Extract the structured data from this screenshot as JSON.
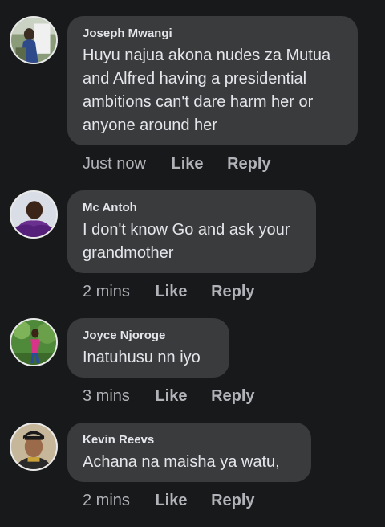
{
  "comments": [
    {
      "author": "Joseph Mwangi",
      "text": "Huyu najua akona nudes za Mutua and Alfred having a presidential ambitions can't dare harm her or anyone around her",
      "time": "Just now",
      "like": "Like",
      "reply": "Reply"
    },
    {
      "author": "Mc Antoh",
      "text": "I don't know Go and ask your grandmother",
      "time": "2 mins",
      "like": "Like",
      "reply": "Reply"
    },
    {
      "author": "Joyce Njoroge",
      "text": "Inatuhusu nn iyo",
      "time": "3 mins",
      "like": "Like",
      "reply": "Reply"
    },
    {
      "author": "Kevin Reevs",
      "text": "Achana na maisha ya watu,",
      "time": "2 mins",
      "like": "Like",
      "reply": "Reply"
    }
  ],
  "colors": {
    "background": "#18191a",
    "bubble": "#3a3b3c",
    "text": "#e4e6eb",
    "meta": "#b0b3b8"
  }
}
